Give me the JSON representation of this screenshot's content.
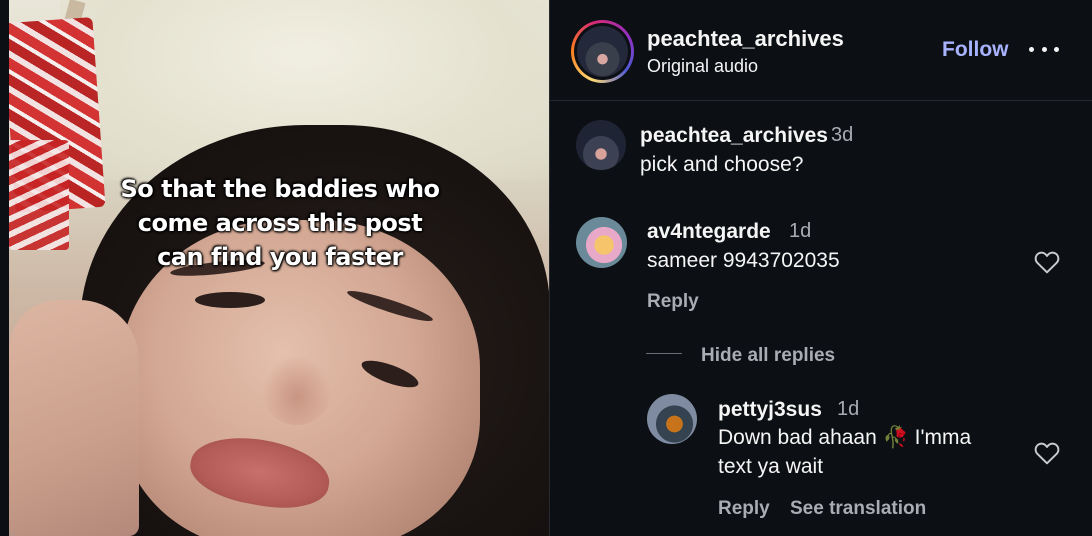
{
  "media": {
    "caption_lines": [
      "So that the baddies who",
      "come across this post",
      "can find you faster"
    ]
  },
  "header": {
    "username": "peachtea_archives",
    "subtitle": "Original audio",
    "follow_label": "Follow",
    "more_icon": "more-horizontal-icon"
  },
  "comments": [
    {
      "username": "peachtea_archives",
      "time": "3d",
      "text": "pick and choose?"
    },
    {
      "username": "av4ntegarde",
      "time": "1d",
      "text": "sameer 9943702035",
      "reply_label": "Reply",
      "hide_replies_label": "Hide all replies",
      "replies": [
        {
          "username": "pettyj3sus",
          "time": "1d",
          "text_line1": "Down bad ahaan 🥀 I'mma",
          "text_line2": "text ya wait",
          "reply_label": "Reply",
          "translation_label": "See translation"
        }
      ]
    }
  ],
  "colors": {
    "background": "#0c0f14",
    "follow_accent": "#a8b3ff",
    "secondary_text": "#a9acb2"
  }
}
